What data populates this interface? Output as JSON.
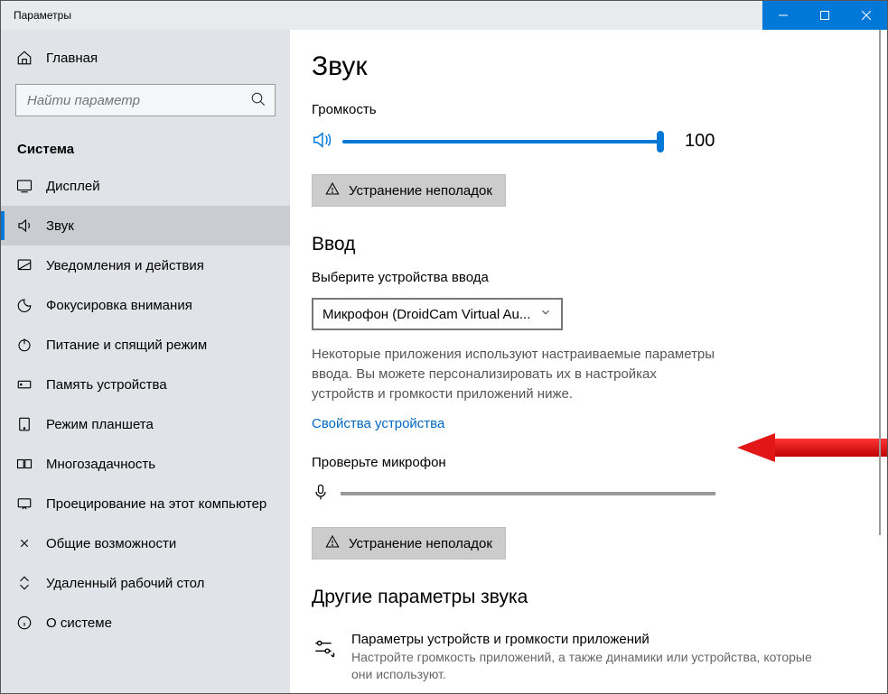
{
  "window": {
    "title": "Параметры"
  },
  "sidebar": {
    "home_label": "Главная",
    "search_placeholder": "Найти параметр",
    "category": "Система",
    "items": [
      {
        "label": "Дисплей"
      },
      {
        "label": "Звук"
      },
      {
        "label": "Уведомления и действия"
      },
      {
        "label": "Фокусировка внимания"
      },
      {
        "label": "Питание и спящий режим"
      },
      {
        "label": "Память устройства"
      },
      {
        "label": "Режим планшета"
      },
      {
        "label": "Многозадачность"
      },
      {
        "label": "Проецирование на этот компьютер"
      },
      {
        "label": "Общие возможности"
      },
      {
        "label": "Удаленный рабочий стол"
      },
      {
        "label": "О системе"
      }
    ]
  },
  "main": {
    "page_title": "Звук",
    "volume_label": "Громкость",
    "volume_value": "100",
    "troubleshoot_label": "Устранение неполадок",
    "input_section": "Ввод",
    "choose_input_label": "Выберите устройства ввода",
    "input_device": "Микрофон (DroidCam Virtual Au...",
    "input_desc": "Некоторые приложения используют настраиваемые параметры ввода. Вы можете персонализировать их в настройках устройств и громкости приложений ниже.",
    "device_props_link": "Свойства устройства",
    "test_mic_label": "Проверьте микрофон",
    "other_section": "Другие параметры звука",
    "app_volume_title": "Параметры устройств и громкости приложений",
    "app_volume_desc": "Настройте громкость приложений, а также динамики или устройства, которые они используют."
  }
}
